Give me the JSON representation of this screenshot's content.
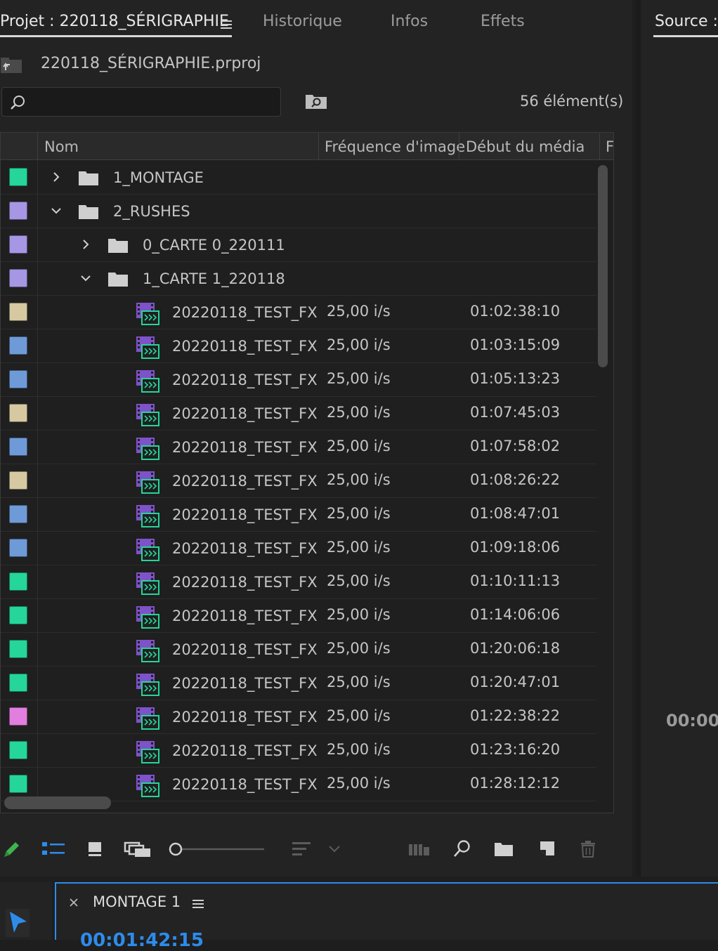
{
  "project_panel": {
    "tabs": [
      {
        "label": "Projet : 220118_SÉRIGRAPHIE",
        "active": true
      },
      {
        "label": "Historique",
        "active": false
      },
      {
        "label": "Infos",
        "active": false
      },
      {
        "label": "Effets",
        "active": false
      }
    ],
    "project_file": "220118_SÉRIGRAPHIE.prproj",
    "search": {
      "value": "",
      "placeholder": ""
    },
    "item_count": "56 élément(s)",
    "columns": [
      "Nom",
      "Fréquence d'image",
      "Début du média",
      "F"
    ],
    "rows": [
      {
        "name": "1_MONTAGE",
        "type": "folder",
        "level": 0,
        "expanded": false,
        "color": "#25d59a",
        "fps": "",
        "start": ""
      },
      {
        "name": "2_RUSHES",
        "type": "folder",
        "level": 0,
        "expanded": true,
        "color": "#a796e4",
        "fps": "",
        "start": ""
      },
      {
        "name": "0_CARTE 0_220111",
        "type": "folder",
        "level": 1,
        "expanded": false,
        "color": "#a796e4",
        "fps": "",
        "start": ""
      },
      {
        "name": "1_CARTE 1_220118",
        "type": "folder",
        "level": 1,
        "expanded": true,
        "color": "#a796e4",
        "fps": "",
        "start": ""
      },
      {
        "name": "20220118_TEST_FX",
        "type": "clip",
        "level": 2,
        "color": "#d6c8a0",
        "fps": "25,00 i/s",
        "start": "01:02:38:10"
      },
      {
        "name": "20220118_TEST_FX",
        "type": "clip",
        "level": 2,
        "color": "#6f9ad8",
        "fps": "25,00 i/s",
        "start": "01:03:15:09"
      },
      {
        "name": "20220118_TEST_FX",
        "type": "clip",
        "level": 2,
        "color": "#6f9ad8",
        "fps": "25,00 i/s",
        "start": "01:05:13:23"
      },
      {
        "name": "20220118_TEST_FX",
        "type": "clip",
        "level": 2,
        "color": "#d6c8a0",
        "fps": "25,00 i/s",
        "start": "01:07:45:03"
      },
      {
        "name": "20220118_TEST_FX",
        "type": "clip",
        "level": 2,
        "color": "#6f9ad8",
        "fps": "25,00 i/s",
        "start": "01:07:58:02"
      },
      {
        "name": "20220118_TEST_FX",
        "type": "clip",
        "level": 2,
        "color": "#d6c8a0",
        "fps": "25,00 i/s",
        "start": "01:08:26:22"
      },
      {
        "name": "20220118_TEST_FX",
        "type": "clip",
        "level": 2,
        "color": "#6f9ad8",
        "fps": "25,00 i/s",
        "start": "01:08:47:01"
      },
      {
        "name": "20220118_TEST_FX",
        "type": "clip",
        "level": 2,
        "color": "#6f9ad8",
        "fps": "25,00 i/s",
        "start": "01:09:18:06"
      },
      {
        "name": "20220118_TEST_FX",
        "type": "clip",
        "level": 2,
        "color": "#25d59a",
        "fps": "25,00 i/s",
        "start": "01:10:11:13"
      },
      {
        "name": "20220118_TEST_FX",
        "type": "clip",
        "level": 2,
        "color": "#25d59a",
        "fps": "25,00 i/s",
        "start": "01:14:06:06"
      },
      {
        "name": "20220118_TEST_FX",
        "type": "clip",
        "level": 2,
        "color": "#25d59a",
        "fps": "25,00 i/s",
        "start": "01:20:06:18"
      },
      {
        "name": "20220118_TEST_FX",
        "type": "clip",
        "level": 2,
        "color": "#25d59a",
        "fps": "25,00 i/s",
        "start": "01:20:47:01"
      },
      {
        "name": "20220118_TEST_FX",
        "type": "clip",
        "level": 2,
        "color": "#e27ee0",
        "fps": "25,00 i/s",
        "start": "01:22:38:22"
      },
      {
        "name": "20220118_TEST_FX",
        "type": "clip",
        "level": 2,
        "color": "#25d59a",
        "fps": "25,00 i/s",
        "start": "01:23:16:20"
      },
      {
        "name": "20220118_TEST_FX",
        "type": "clip",
        "level": 2,
        "color": "#25d59a",
        "fps": "25,00 i/s",
        "start": "01:28:12:12"
      }
    ],
    "toolbar_icons": [
      "pencil-icon",
      "list-view-icon",
      "icon-view-icon",
      "freeform-view-icon",
      "zoom-slider",
      "sort-icon",
      "automate-icon",
      "find-icon",
      "new-bin-icon",
      "new-item-icon",
      "trash-icon"
    ]
  },
  "source_panel": {
    "tab": "Source : (",
    "timecode": "00:00"
  },
  "timeline": {
    "sequence": "MONTAGE 1",
    "timecode": "00:01:42:15"
  },
  "colors": {
    "accent": "#2d8ceb",
    "panel_bg": "#232323",
    "frame_bg": "#1e1e1e"
  }
}
